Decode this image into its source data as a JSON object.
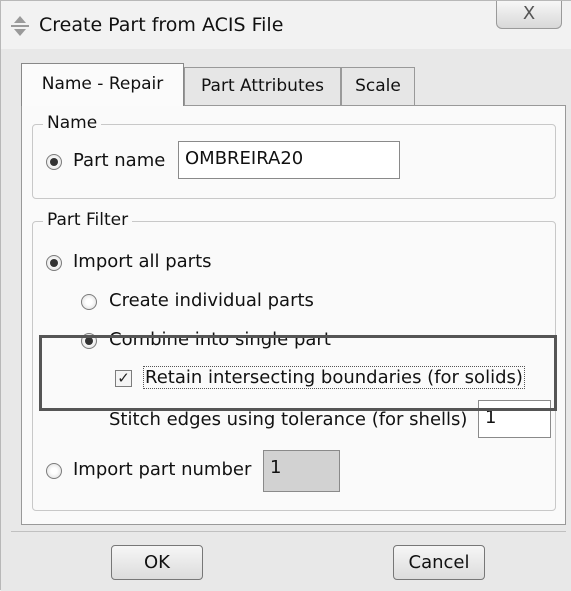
{
  "window": {
    "title": "Create Part from ACIS File",
    "close_icon": "X"
  },
  "tabs": [
    {
      "label": "Name - Repair",
      "active": true
    },
    {
      "label": "Part Attributes",
      "active": false
    },
    {
      "label": "Scale",
      "active": false
    }
  ],
  "name_group": {
    "label": "Name",
    "part_name_label": "Part name",
    "part_name_value": "OMBREIRA20"
  },
  "filter_group": {
    "label": "Part Filter",
    "import_all_label": "Import all parts",
    "create_individual_label": "Create individual parts",
    "combine_label": "Combine into single part",
    "retain_label": "Retain intersecting boundaries (for solids)",
    "retain_checked": true,
    "stitch_label": "Stitch edges using tolerance (for shells)",
    "stitch_value": "1",
    "import_number_label": "Import part number",
    "import_number_value": "1"
  },
  "footer": {
    "ok_label": "OK",
    "cancel_label": "Cancel"
  }
}
